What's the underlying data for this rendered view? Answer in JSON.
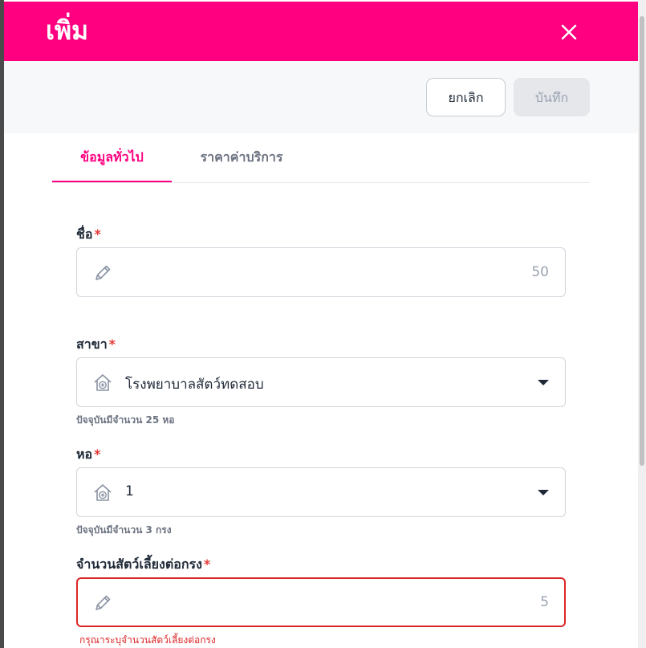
{
  "header": {
    "title": "เพิ่ม"
  },
  "toolbar": {
    "cancel_label": "ยกเลิก",
    "save_label": "บันทึก"
  },
  "tabs": [
    {
      "label": "ข้อมูลทั่วไป",
      "active": true
    },
    {
      "label": "ราคาค่าบริการ",
      "active": false
    }
  ],
  "form": {
    "required_mark": "*",
    "name": {
      "label": "ชื่อ",
      "value": "",
      "counter": "50",
      "icon": "pencil-icon"
    },
    "branch": {
      "label": "สาขา",
      "value": "โรงพยาบาลสัตว์ทดสอบ",
      "hint": "ปัจจุบันมีจำนวน 25 หอ",
      "icon": "hospital-house-icon"
    },
    "ward": {
      "label": "หอ",
      "value": "1",
      "hint": "ปัจจุบันมีจำนวน 3 กรง",
      "icon": "hospital-house-icon"
    },
    "pets_per_cage": {
      "label": "จำนวนสัตว์เลี้ยงต่อกรง",
      "value": "",
      "counter": "5",
      "error": "กรุณาระบุจำนวนสัตว์เลี้ยงต่อกรง",
      "icon": "pencil-icon"
    }
  },
  "colors": {
    "accent": "#ff0080",
    "error": "#dc2626"
  }
}
